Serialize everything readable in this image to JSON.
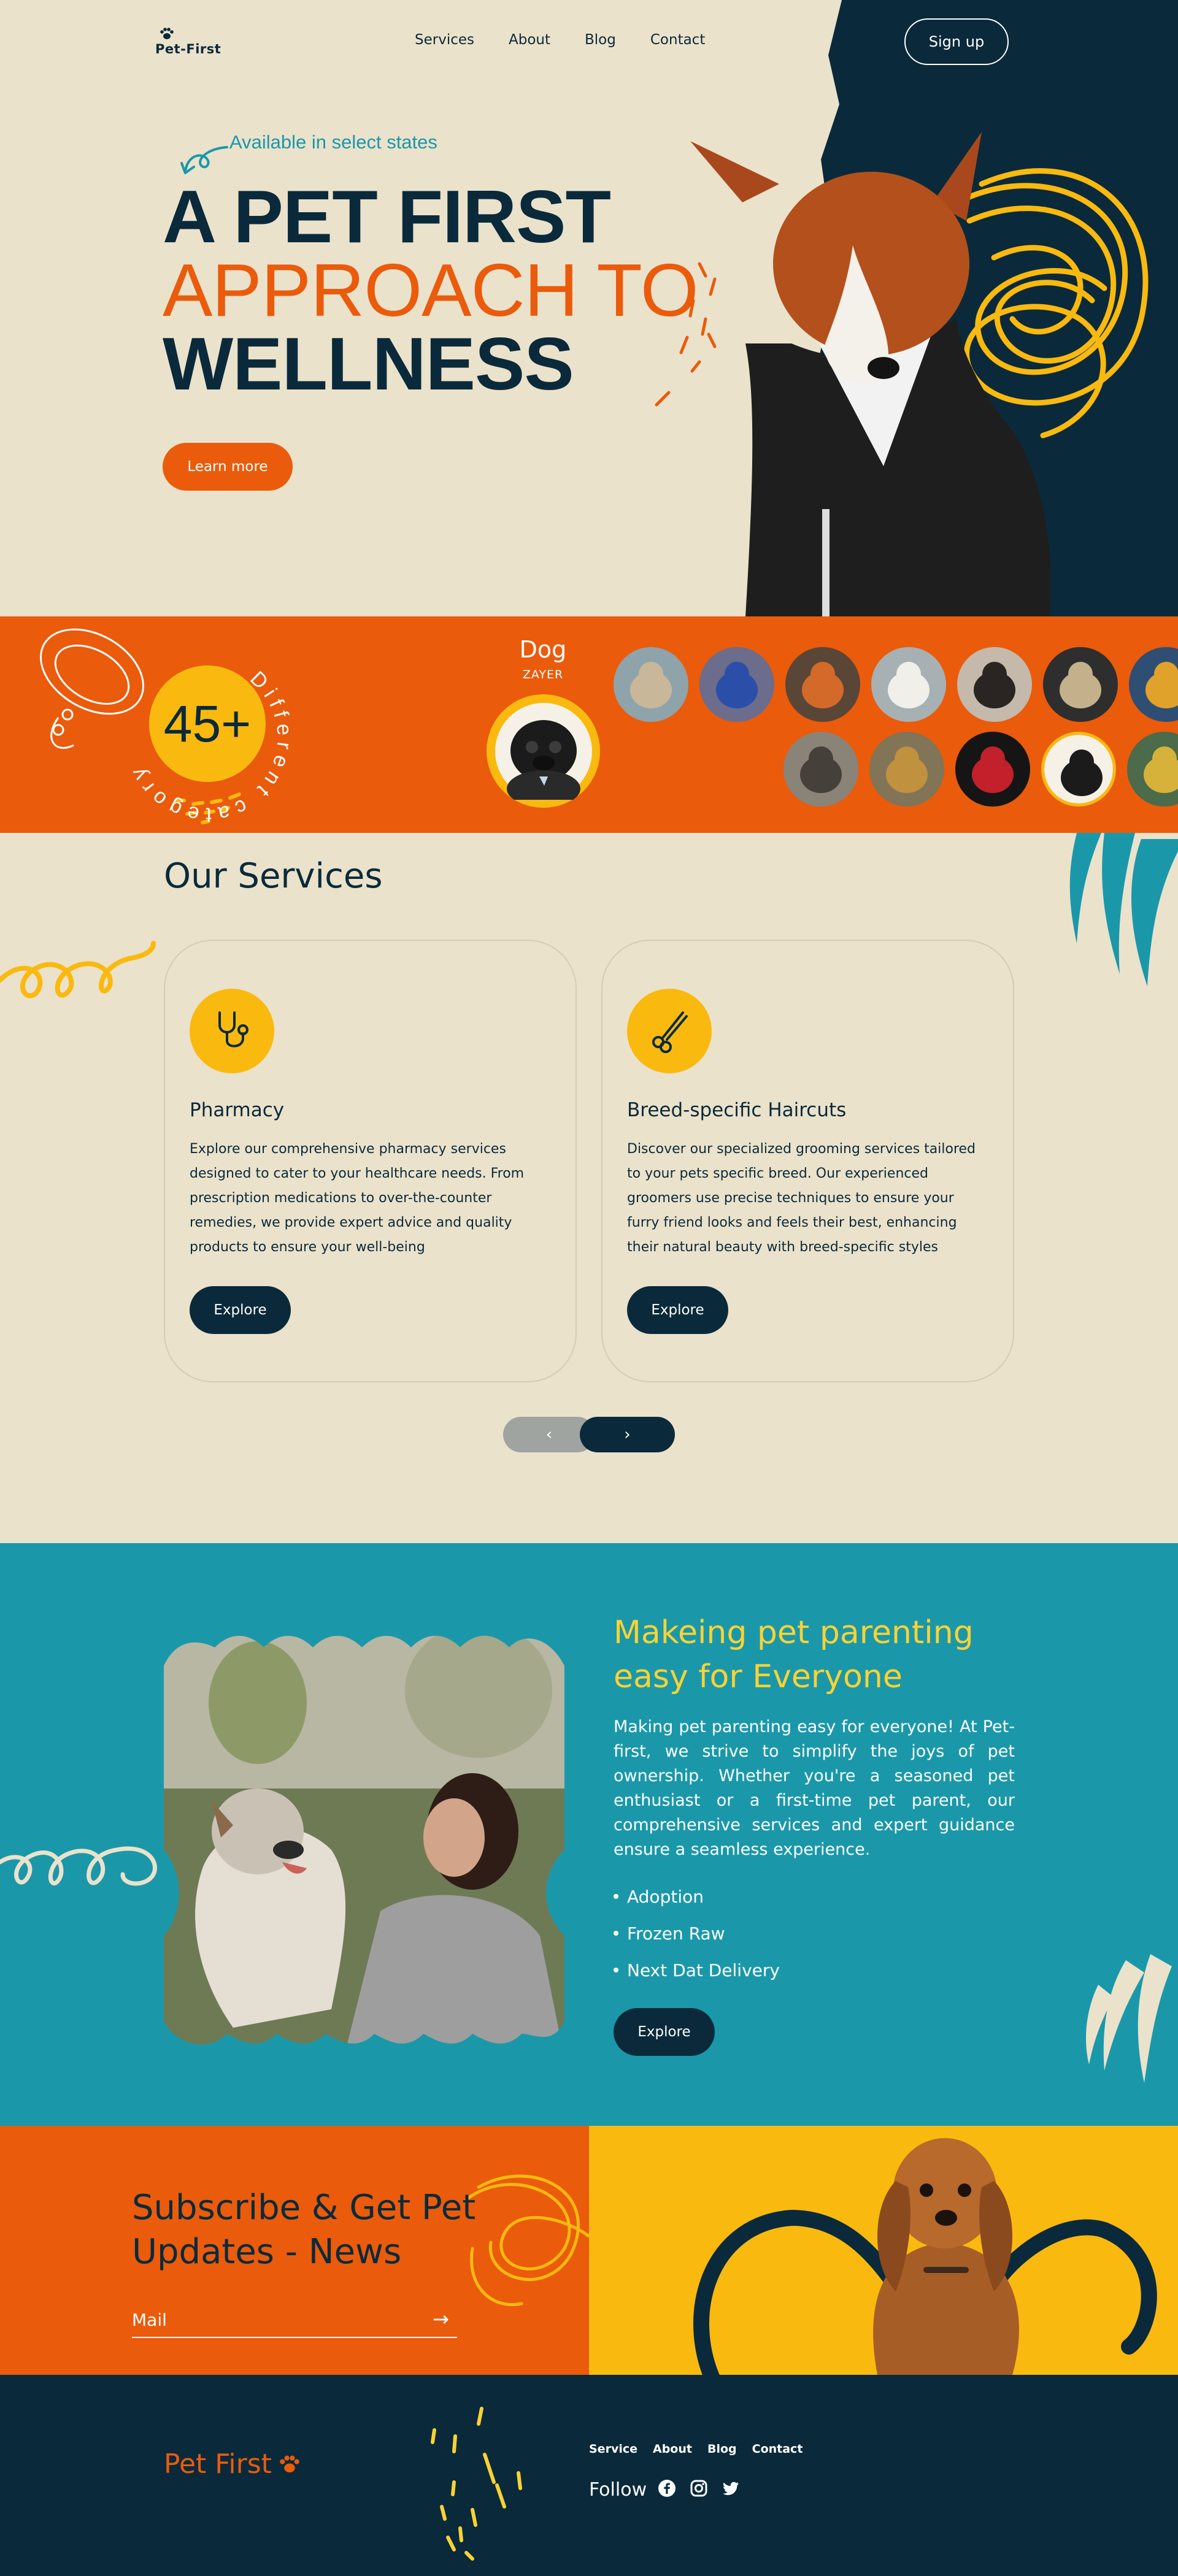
{
  "nav": {
    "logo": "Pet-First",
    "links": [
      "Services",
      "About",
      "Blog",
      "Contact"
    ],
    "signup": "Sign up"
  },
  "hero": {
    "tagline": "Available in select states",
    "line1": "A PET FIRST",
    "line2": "APPROACH TO",
    "line3": "WELLNESS",
    "cta": "Learn more"
  },
  "categories": {
    "count": "45+",
    "ring_text": "Different category",
    "selected_name": "Dog",
    "selected_sub": "ZAYER",
    "thumbnails": [
      "cat",
      "bluebird",
      "fox",
      "white-cat",
      "guinea-pig",
      "owl",
      "parrot",
      "cat-pair",
      "lion",
      "red-bird",
      "pug",
      "parrot-2"
    ]
  },
  "services": {
    "title": "Our Services",
    "cards": [
      {
        "title": "Pharmacy",
        "icon": "stethoscope-icon",
        "text": "Explore our comprehensive pharmacy services designed to cater to your healthcare needs. From prescription medications to over-the-counter remedies, we provide expert advice and quality products to ensure your well-being",
        "button": "Explore"
      },
      {
        "title": "Breed-specific Haircuts",
        "icon": "scissors-icon",
        "text": "Discover our specialized grooming services tailored to your pets specific breed. Our experienced groomers use precise techniques to ensure your furry friend looks and feels their best, enhancing their natural beauty with breed-specific styles",
        "button": "Explore"
      }
    ],
    "prev": "‹",
    "next": "›"
  },
  "parenting": {
    "title": "Makeing pet parenting easy for Everyone",
    "text": "Making pet parenting easy for everyone! At Pet-first, we strive to simplify the joys of pet ownership. Whether you're a seasoned pet enthusiast or a first-time pet parent, our comprehensive services and expert guidance ensure a seamless experience.",
    "items": [
      "Adoption",
      "Frozen Raw",
      "Next Dat Delivery"
    ],
    "button": "Explore"
  },
  "subscribe": {
    "title": "Subscribe & Get Pet Updates - News",
    "mail_label": "Mail",
    "arrow": "→"
  },
  "footer": {
    "logo": "Pet First",
    "links": [
      "Service",
      "About",
      "Blog",
      "Contact"
    ],
    "follow": "Follow",
    "socials": [
      "facebook-icon",
      "instagram-icon",
      "twitter-icon"
    ]
  },
  "colors": {
    "cream": "#EBE2CB",
    "navy": "#0A2A3B",
    "orange": "#EA5B0C",
    "yellow": "#FAB90F",
    "teal": "#1A98AA"
  }
}
